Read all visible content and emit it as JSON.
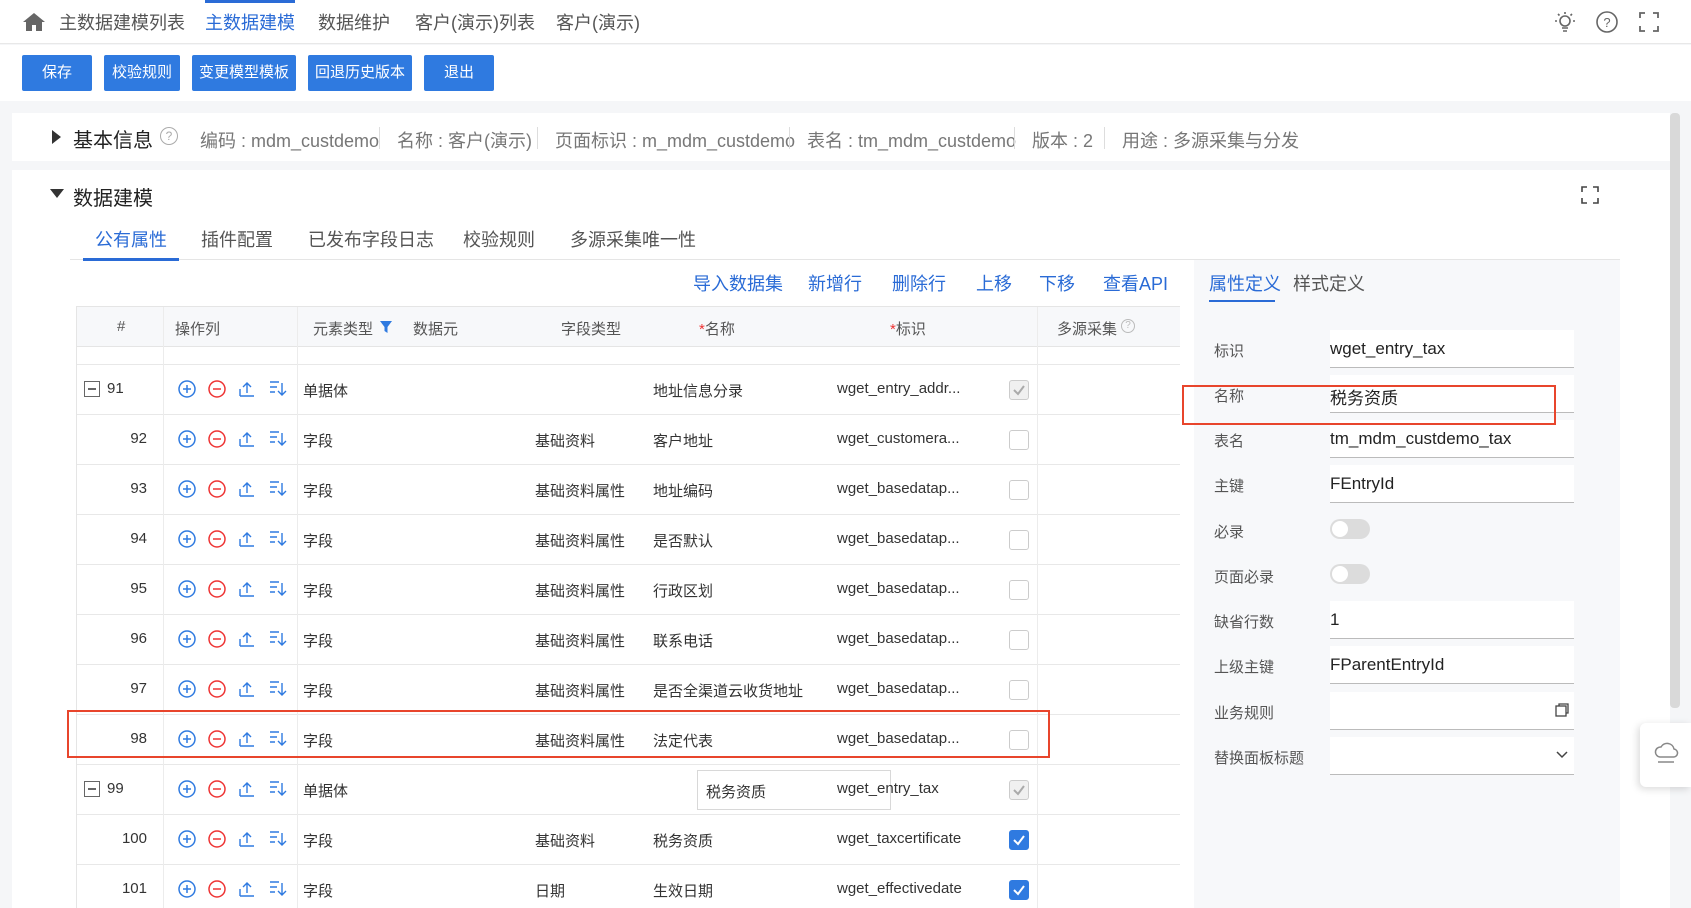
{
  "topnav": {
    "tabs": [
      "主数据建模列表",
      "主数据建模",
      "数据维护",
      "客户(演示)列表",
      "客户(演示)"
    ],
    "active_tab": "主数据建模"
  },
  "toolbar": {
    "save": "保存",
    "validate_rules": "校验规则",
    "change_template": "变更模型模板",
    "rollback": "回退历史版本",
    "exit": "退出"
  },
  "basic_info": {
    "title": "基本信息",
    "code": "编码 : mdm_custdemo",
    "name": "名称 : 客户(演示)",
    "page_id": "页面标识 : m_mdm_custdemo",
    "table": "表名 : tm_mdm_custdemo",
    "version": "版本 : 2",
    "usage": "用途 : 多源采集与分发"
  },
  "modeling": {
    "title": "数据建模",
    "subtabs": [
      "公有属性",
      "插件配置",
      "已发布字段日志",
      "校验规则",
      "多源采集唯一性"
    ],
    "actions": {
      "import": "导入数据集",
      "add_row": "新增行",
      "delete_row": "删除行",
      "move_up": "上移",
      "move_down": "下移",
      "view_api": "查看API"
    },
    "columns": {
      "index": "#",
      "ops": "操作列",
      "element_type": "元素类型",
      "data_element": "数据元",
      "field_type": "字段类型",
      "name": "名称",
      "identifier": "标识",
      "multi_source": "多源采集"
    },
    "rows": [
      {
        "num": "91",
        "type": "单据体",
        "field_type": "",
        "name": "地址信息分录",
        "id": "wget_entry_addr...",
        "check": "disabled"
      },
      {
        "num": "92",
        "type": "字段",
        "field_type": "基础资料",
        "name": "客户地址",
        "id": "wget_customera...",
        "check": "off"
      },
      {
        "num": "93",
        "type": "字段",
        "field_type": "基础资料属性",
        "name": "地址编码",
        "id": "wget_basedatap...",
        "check": "off"
      },
      {
        "num": "94",
        "type": "字段",
        "field_type": "基础资料属性",
        "name": "是否默认",
        "id": "wget_basedatap...",
        "check": "off"
      },
      {
        "num": "95",
        "type": "字段",
        "field_type": "基础资料属性",
        "name": "行政区划",
        "id": "wget_basedatap...",
        "check": "off"
      },
      {
        "num": "96",
        "type": "字段",
        "field_type": "基础资料属性",
        "name": "联系电话",
        "id": "wget_basedatap...",
        "check": "off"
      },
      {
        "num": "97",
        "type": "字段",
        "field_type": "基础资料属性",
        "name": "是否全渠道云收货地址",
        "id": "wget_basedatap...",
        "check": "off"
      },
      {
        "num": "98",
        "type": "字段",
        "field_type": "基础资料属性",
        "name": "法定代表",
        "id": "wget_basedatap...",
        "check": "off"
      },
      {
        "num": "99",
        "type": "单据体",
        "field_type": "",
        "name": "税务资质",
        "id": "wget_entry_tax",
        "check": "disabled"
      },
      {
        "num": "100",
        "type": "字段",
        "field_type": "基础资料",
        "name": "税务资质",
        "id": "wget_taxcertificate",
        "check": "on"
      },
      {
        "num": "101",
        "type": "字段",
        "field_type": "日期",
        "name": "生效日期",
        "id": "wget_effectivedate",
        "check": "on"
      }
    ]
  },
  "props": {
    "tabs": [
      "属性定义",
      "样式定义"
    ],
    "identifier_label": "标识",
    "identifier": "wget_entry_tax",
    "name_label": "名称",
    "name": "税务资质",
    "table_label": "表名",
    "table": "tm_mdm_custdemo_tax",
    "pk_label": "主键",
    "pk": "FEntryId",
    "required_label": "必录",
    "page_required_label": "页面必录",
    "default_rows_label": "缺省行数",
    "default_rows": "1",
    "parent_pk_label": "上级主键",
    "parent_pk": "FParentEntryId",
    "biz_rule_label": "业务规则",
    "biz_rule": "",
    "panel_title_label": "替换面板标题",
    "panel_title": ""
  }
}
